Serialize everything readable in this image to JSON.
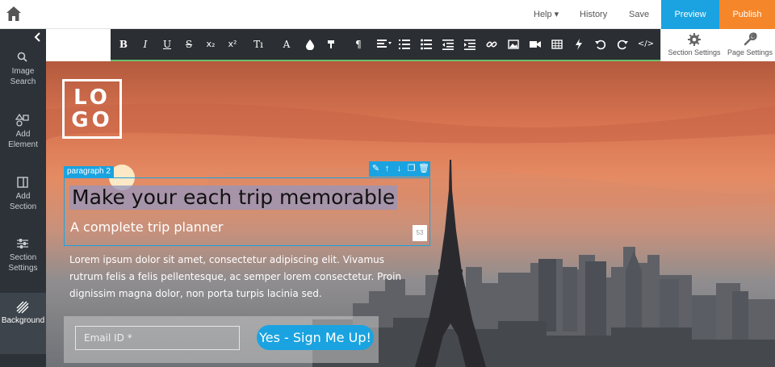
{
  "topbar": {
    "help_label": "Help ▾",
    "history_label": "History",
    "save_label": "Save",
    "preview_label": "Preview",
    "publish_label": "Publish"
  },
  "sidebar": {
    "items": [
      {
        "line1": "Image",
        "line2": "Search",
        "icon": "search-icon"
      },
      {
        "line1": "Add",
        "line2": "Element",
        "icon": "shapes-icon"
      },
      {
        "line1": "Add",
        "line2": "Section",
        "icon": "section-icon"
      },
      {
        "line1": "Section",
        "line2": "Settings",
        "icon": "sliders-icon"
      },
      {
        "line1": "Background",
        "line2": "",
        "icon": "background-icon"
      }
    ]
  },
  "toolbar": {
    "bold": "B",
    "italic": "I",
    "underline": "U",
    "strike": "S",
    "subscript": "x₂",
    "superscript": "x²",
    "text_size": "Tı",
    "font": "A",
    "paragraph": "¶",
    "code": "</>"
  },
  "settings": {
    "section_settings_label": "Section Settings",
    "page_settings_label": "Page Settings"
  },
  "canvas": {
    "logo_line1": "LO",
    "logo_line2": "GO",
    "selection_tag": "paragraph 2",
    "headline": "Make your each trip memorable",
    "subline": "A complete trip planner",
    "resize_badge": "53",
    "body": "Lorem ipsum dolor sit amet, consectetur adipiscing elit. Vivamus rutrum felis a felis pellentesque, ac semper lorem consectetur. Proin dignissim magna dolor, non porta turpis lacinia sed.",
    "email_placeholder": "Email ID *",
    "signup_label": "Yes - Sign Me Up!"
  },
  "colors": {
    "accent": "#1aa3e0",
    "publish": "#f5862a",
    "sidebar": "#2c3238",
    "toolbar": "#2b2e33"
  }
}
